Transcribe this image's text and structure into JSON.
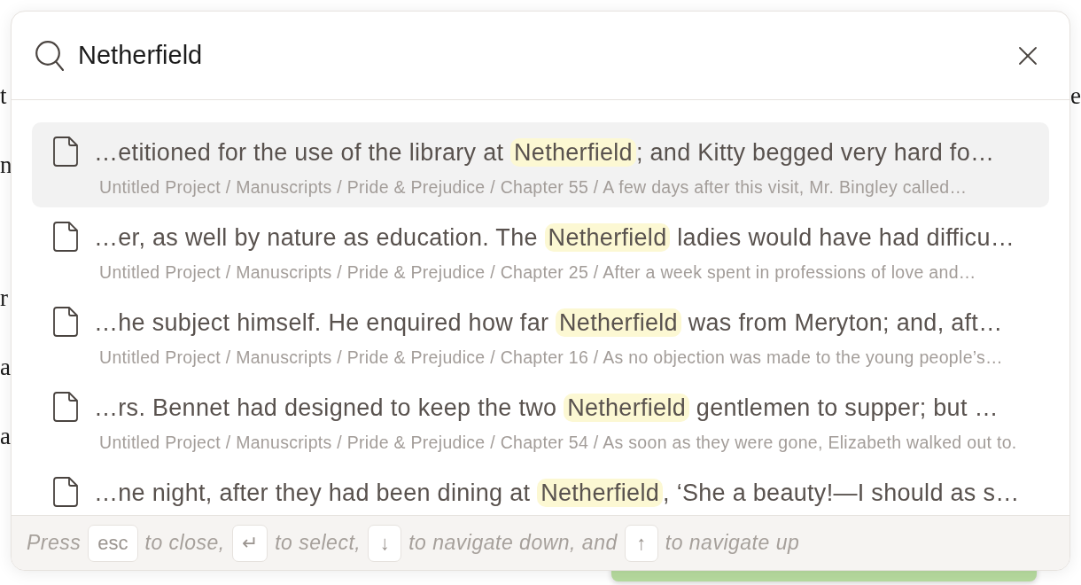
{
  "background": {
    "left_fragments": [
      "t",
      "n",
      "r",
      "a",
      "a"
    ],
    "right_fragments": [
      "e"
    ]
  },
  "search": {
    "value": "Netherfield"
  },
  "results": [
    {
      "selected": true,
      "before": "…etitioned for the use of the library at ",
      "match": "Netherfield",
      "after": "; and Kitty begged very hard fo…",
      "path": "Untitled Project / Manuscripts / Pride & Prejudice / Chapter 55 / A few days after this visit, Mr. Bingley called…"
    },
    {
      "selected": false,
      "before": "…er, as well by nature as education. The ",
      "match": "Netherfield",
      "after": " ladies would have had difficu…",
      "path": "Untitled Project / Manuscripts / Pride & Prejudice / Chapter 25 / After a week spent in professions of love and…"
    },
    {
      "selected": false,
      "before": "…he subject himself. He enquired how far ",
      "match": "Netherfield",
      "after": " was from Meryton; and, aft…",
      "path": "Untitled Project / Manuscripts / Pride & Prejudice / Chapter 16 / As no objection was made to the young people’s…"
    },
    {
      "selected": false,
      "before": "…rs. Bennet had designed to keep the two ",
      "match": "Netherfield",
      "after": " gentlemen to supper; but …",
      "path": "Untitled Project / Manuscripts / Pride & Prejudice / Chapter 54 / As soon as they were gone, Elizabeth walked out to."
    },
    {
      "selected": false,
      "before": "…ne night, after they had been dining at ",
      "match": "Netherfield",
      "after": ", ‘She a beauty!—I should as s…"
    }
  ],
  "footer": [
    {
      "kind": "text",
      "text": "Press"
    },
    {
      "kind": "key",
      "text": "esc"
    },
    {
      "kind": "text",
      "text": "to close,"
    },
    {
      "kind": "key",
      "text": "↵"
    },
    {
      "kind": "text",
      "text": "to select,"
    },
    {
      "kind": "key",
      "text": "↓"
    },
    {
      "kind": "text",
      "text": "to navigate down, and"
    },
    {
      "kind": "key",
      "text": "↑"
    },
    {
      "kind": "text",
      "text": "to navigate up"
    }
  ]
}
